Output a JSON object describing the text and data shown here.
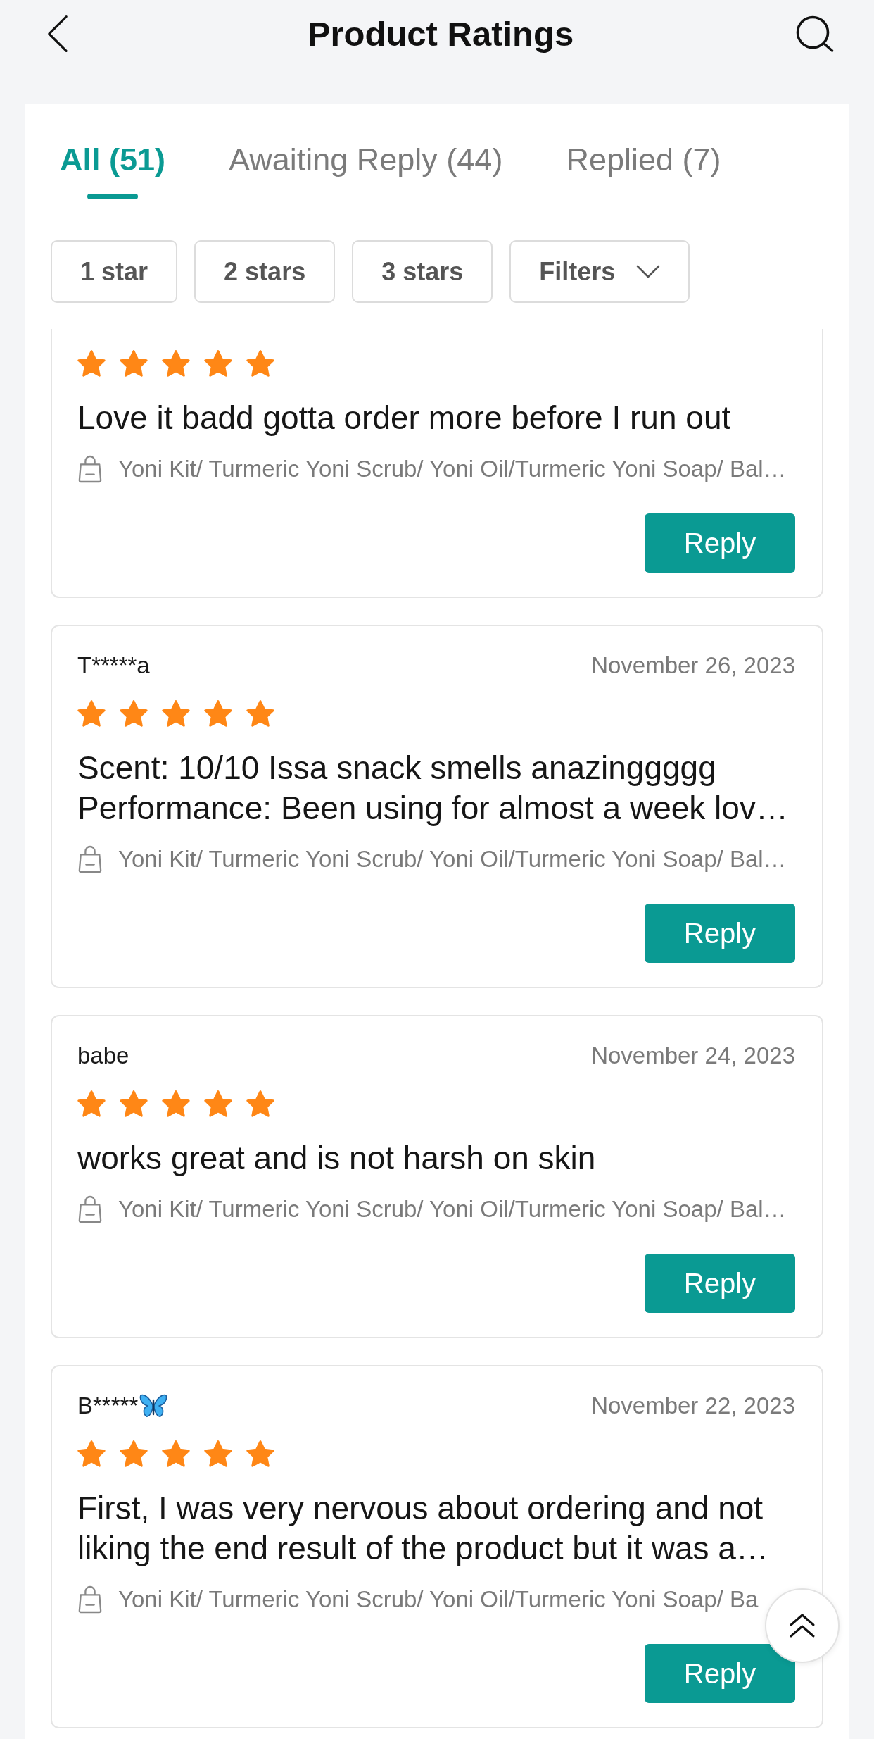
{
  "header": {
    "title": "Product Ratings"
  },
  "tabs": [
    {
      "label": "All (51)",
      "selected": true
    },
    {
      "label": "Awaiting Reply (44)",
      "selected": false
    },
    {
      "label": "Replied (7)",
      "selected": false
    }
  ],
  "filters": [
    {
      "label": "1 star",
      "kind": "chip"
    },
    {
      "label": "2 stars",
      "kind": "chip"
    },
    {
      "label": "3 stars",
      "kind": "chip"
    },
    {
      "label": "Filters",
      "kind": "dropdown"
    }
  ],
  "reviews": [
    {
      "stars": 5,
      "text": "Love it badd gotta order more before I run out",
      "product": "Yoni Kit/ Turmeric Yoni Scrub/ Yoni Oil/Turmeric Yoni Soap/ Bal…",
      "reply_label": "Reply"
    },
    {
      "reviewer": "T*****a",
      "name_icon": false,
      "date": "November 26, 2023",
      "stars": 5,
      "text": "Scent: 10/10 Issa snack smells anazinggggg Performance: Been using for almost a week lov…",
      "product": "Yoni Kit/ Turmeric Yoni Scrub/ Yoni Oil/Turmeric Yoni Soap/ Bal…",
      "reply_label": "Reply"
    },
    {
      "reviewer": "babe",
      "name_icon": false,
      "date": "November 24, 2023",
      "stars": 5,
      "text": "works great and is not harsh on skin",
      "product": "Yoni Kit/ Turmeric Yoni Scrub/ Yoni Oil/Turmeric Yoni Soap/ Bal…",
      "reply_label": "Reply"
    },
    {
      "reviewer": "B*****",
      "name_icon": true,
      "date": "November 22, 2023",
      "stars": 5,
      "text": "First, I was very nervous about ordering and not liking the end result of the product but it was a…",
      "product": "Yoni Kit/ Turmeric Yoni Scrub/ Yoni Oil/Turmeric Yoni Soap/ Ba",
      "reply_label": "Reply"
    }
  ]
}
